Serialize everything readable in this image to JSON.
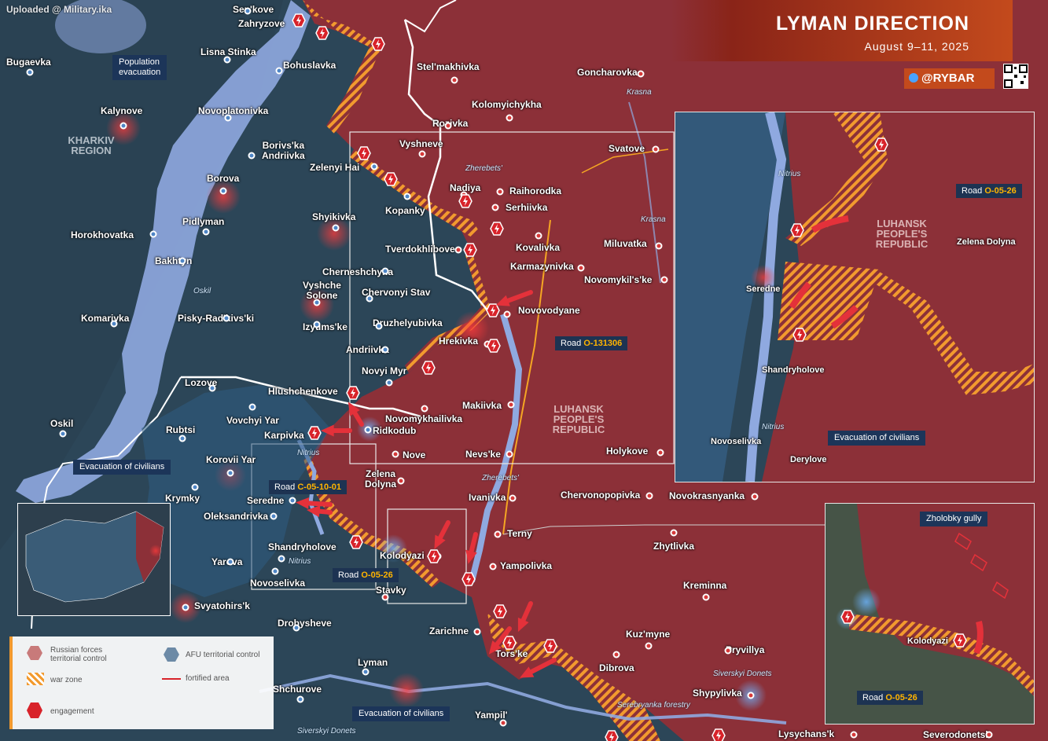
{
  "watermark": "Uploaded @ Military.ika",
  "header": {
    "title": "LYMAN DIRECTION",
    "subtitle": "August 9–11, 2025",
    "brand": "@RYBAR"
  },
  "regions": {
    "kharkiv": "KHARKIV\nREGION",
    "luhansk_main": "LUHANSK\nPEOPLE'S\nREPUBLIC",
    "luhansk_inset": "LUHANSK\nPEOPLE'S\nREPUBLIC"
  },
  "settlements_blue": [
    "Sen'kove",
    "Zahryzove",
    "Lisna Stinka",
    "Bohuslavka",
    "Bugaevka",
    "Kalynove",
    "Novoplatonivka",
    "Borivs'ka Andriivka",
    "Zelenyi Hai",
    "Borova",
    "Kopanky",
    "Shyikivka",
    "Pidlyman",
    "Horokhovatka",
    "Bakhtyn",
    "Cherneshchyna",
    "Vyshche Solone",
    "Chervonyi Stav",
    "Komarivka",
    "Pisky-Rad'kivs'ki",
    "Izyums'ke",
    "Druzhelyubivka",
    "Andriivka",
    "Novyi Myr",
    "Lozove",
    "Hlushchenkove",
    "Vovchyi Yar",
    "Rubtsi",
    "Oskil",
    "Karpivka",
    "Ridkodub",
    "Korovii Yar",
    "Krymky",
    "Oleksandrivka",
    "Seredne",
    "Shandryholove",
    "Yarova",
    "Novoselivka",
    "Svyatohirs'k",
    "Drobysheve",
    "Lyman",
    "Shchurove"
  ],
  "settlements_red": [
    "Stel'makhivka",
    "Goncharovka",
    "Kolomyichykha",
    "Rozivka",
    "Vyshneve",
    "Svatove",
    "Nadiya",
    "Raihorodka",
    "Serhiivka",
    "Tverdokhlibove",
    "Kovalivka",
    "Miluvatka",
    "Karmazynivka",
    "Novomykil's'ke",
    "Novovodyane",
    "Hrekivka",
    "Novomykhailivka",
    "Makiivka",
    "Nove",
    "Nevs'ke",
    "Zelena Dolyna",
    "Holykove",
    "Ivanivka",
    "Chervonopopivka",
    "Novokrasnyanka",
    "Terny",
    "Kolodyazi",
    "Yampolivka",
    "Zhytlivka",
    "Stavky",
    "Kreminna",
    "Zarichne",
    "Tors'ke",
    "Kuz'myne",
    "Pryvillya",
    "Dibrova",
    "Shypylivka",
    "Yampil'",
    "Lysychans'k",
    "Severodonetsk"
  ],
  "water_labels": [
    "Oskil",
    "Nitrius",
    "Zherebets'",
    "Krasna",
    "Krasna",
    "Zherebets'",
    "Nitrius",
    "Siverskyi Donets",
    "Siverskyi Donets",
    "Serebryanka forestry"
  ],
  "roads": {
    "o131306": {
      "prefix": "Road",
      "code": "O-131306"
    },
    "c051001": {
      "prefix": "Road",
      "code": "C-05-10-01"
    },
    "o0526_main": {
      "prefix": "Road",
      "code": "O-05-26"
    },
    "o0526_inset1": {
      "prefix": "Road",
      "code": "O-05-26"
    },
    "o0526_inset2": {
      "prefix": "Road",
      "code": "O-05-26"
    }
  },
  "callouts": {
    "population_evac": "Population\nevacuation",
    "evac_civilians_1": "Evacuation of civilians",
    "evac_civilians_2": "Evacuation of civilians",
    "evac_civilians_inset": "Evacuation of civilians",
    "zholobky": "Zholobky gully"
  },
  "inset1": {
    "settlements": [
      "Zelena Dolyna",
      "Seredne",
      "Shandryholove",
      "Novoselivka",
      "Derylove"
    ],
    "water": [
      "Nitrius",
      "Nitrius"
    ]
  },
  "inset2": {
    "settlements": [
      "Kolodyazi"
    ]
  },
  "legend": {
    "russian": "Russian forces\nterritorial control",
    "afu": "AFU territorial control",
    "war_zone": "war zone",
    "fortified": "fortified area",
    "engagement": "engagement"
  },
  "colors": {
    "russian": "#8c3038",
    "afu": "#2f4c63",
    "war_zone": "#f29a2e",
    "engagement": "#d8232a",
    "accent": "#c34a1c",
    "water": "#8fa9e0"
  }
}
